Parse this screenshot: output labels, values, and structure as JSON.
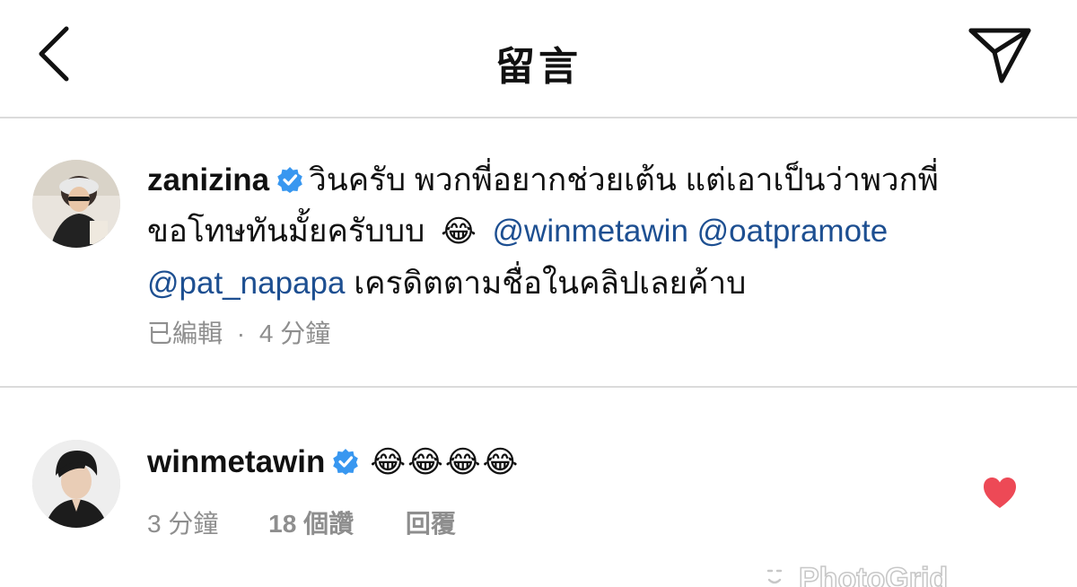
{
  "header": {
    "title": "留言",
    "back_icon": "chevron-left-icon",
    "send_icon": "paper-plane-icon"
  },
  "comments": [
    {
      "username": "zanizina",
      "verified": true,
      "line1_text": "วินครับ พวกพี่อยากช่วยเต้น แต่เอาเป็นว่าพวกพี่",
      "line2_text": "ขอโทษทันมั้ยครับบบ",
      "emoji": "😂",
      "mention1": "@winmetawin",
      "mention2": "@oatpramote",
      "mention3": "@pat_napapa",
      "line3_text": "เครดิตตามชื่อในคลิปเลยค้าบ",
      "edited_label": "已編輯",
      "separator": "·",
      "time": "4 分鐘"
    },
    {
      "username": "winmetawin",
      "verified": true,
      "emojis": "😂😂😂😂",
      "time": "3 分鐘",
      "likes": "18 個讚",
      "reply_label": "回覆",
      "liked": true
    }
  ],
  "colors": {
    "mention": "#1d4f91",
    "meta_gray": "#8e8e8e",
    "verified_blue": "#3897f0",
    "heart_red": "#ed4956",
    "divider": "#dbdbdb"
  },
  "watermark": "PhotoGrid"
}
